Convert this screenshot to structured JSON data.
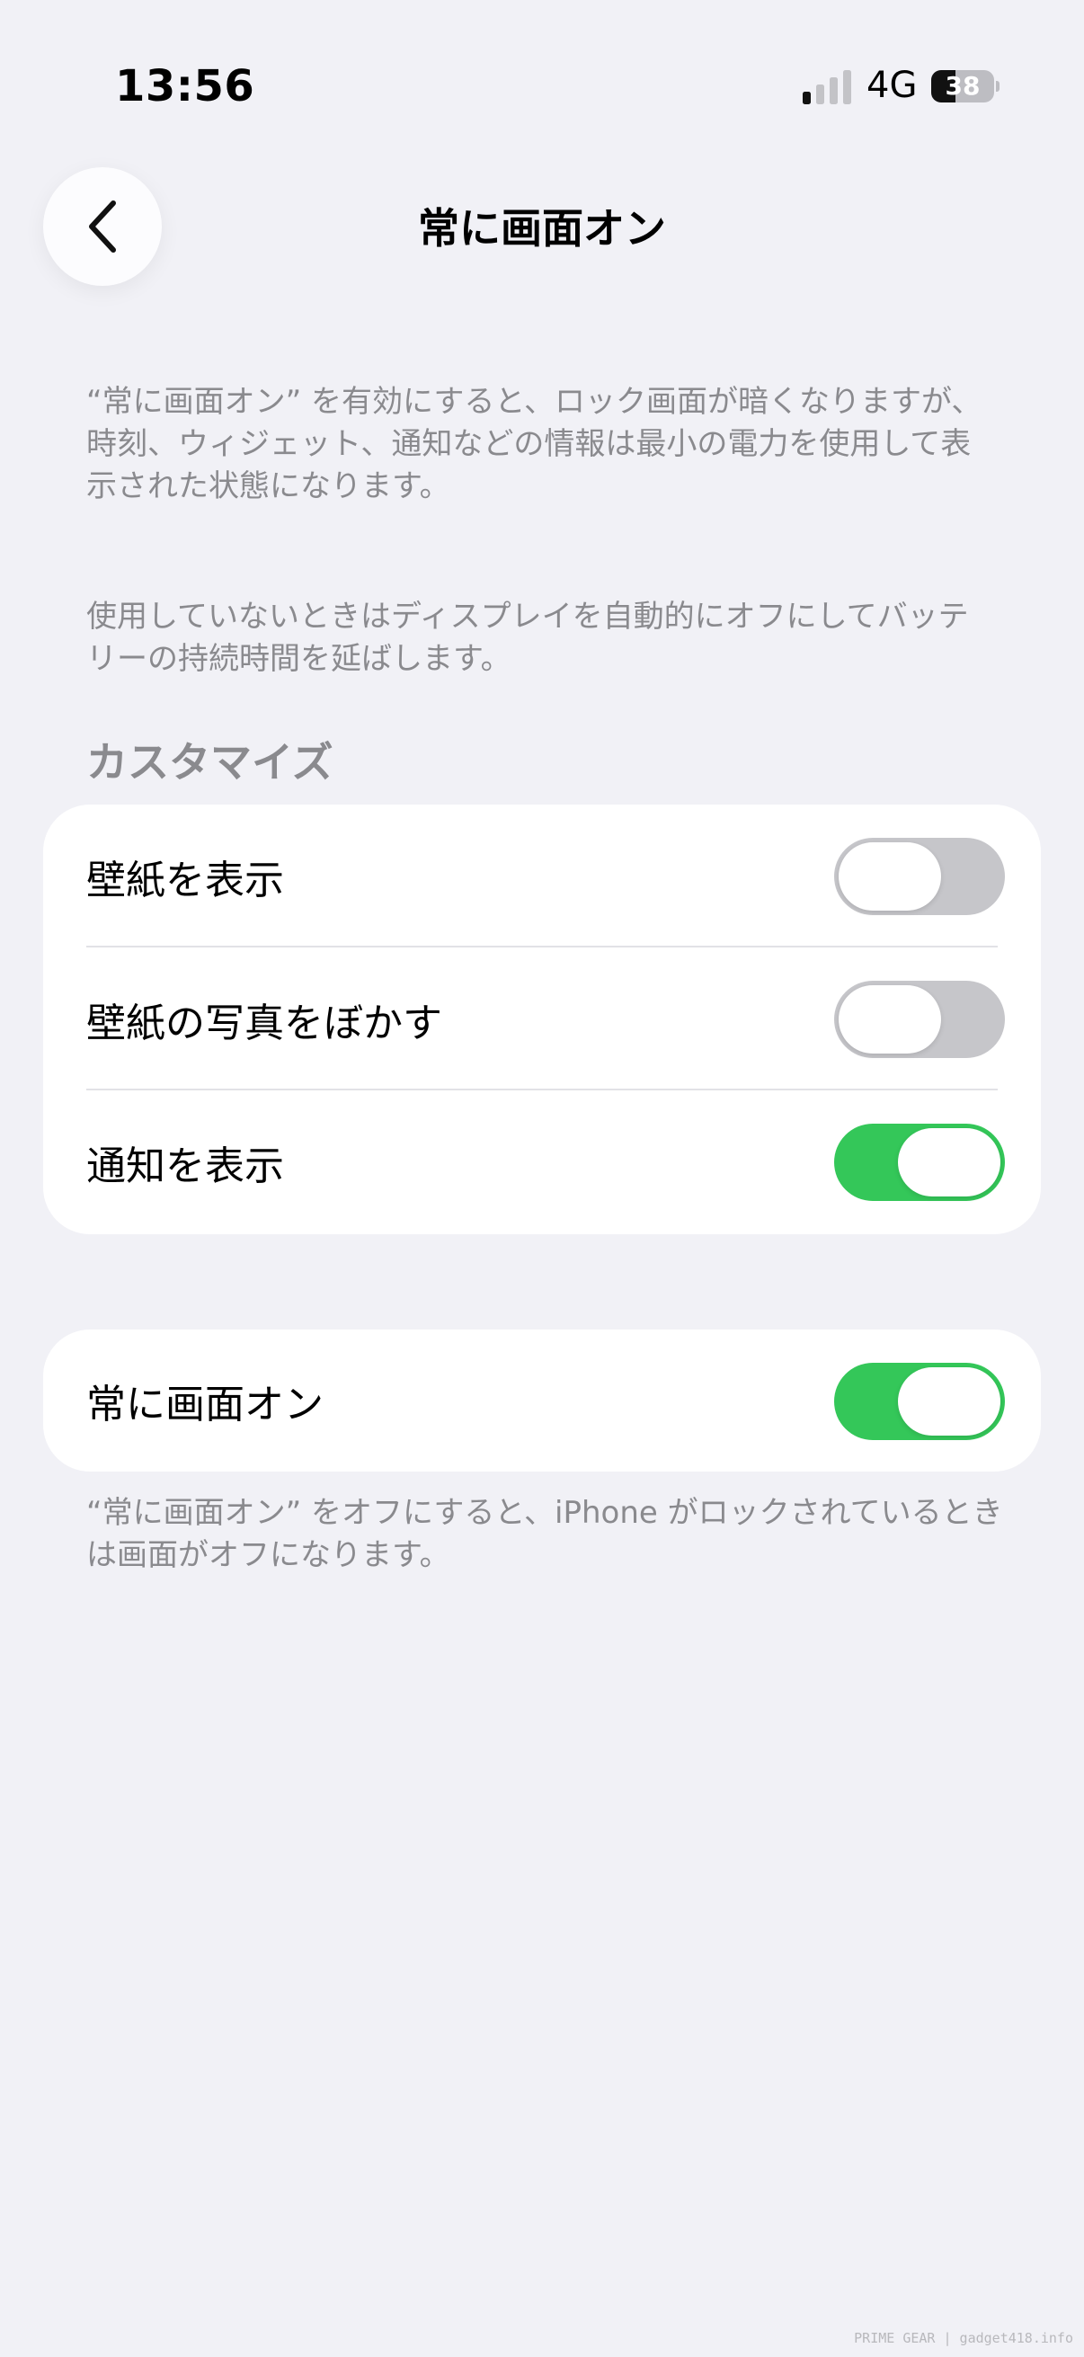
{
  "status_bar": {
    "time": "13:56",
    "network": "4G",
    "battery_percent": "38",
    "battery_level": 0.38,
    "signal_icon": "cellular-signal-icon"
  },
  "nav": {
    "back_icon": "chevron-left-icon",
    "title": "常に画面オン"
  },
  "descriptions": {
    "first": "“常に画面オン” を有効にすると、ロック画面が暗くなりますが、時刻、ウィジェット、通知などの情報は最小の電力を使用して表示された状態になります。",
    "second": "使用していないときはディスプレイを自動的にオフにしてバッテリーの持続時間を延ばします。"
  },
  "customize": {
    "header": "カスタマイズ",
    "rows": [
      {
        "label": "壁紙を表示",
        "on": false
      },
      {
        "label": "壁紙の写真をぼかす",
        "on": false
      },
      {
        "label": "通知を表示",
        "on": true
      }
    ]
  },
  "always_on": {
    "label": "常に画面オン",
    "on": true,
    "footer": "“常に画面オン” をオフにすると、iPhone がロックされているときは画面がオフになります。"
  },
  "colors": {
    "background": "#f1f1f6",
    "toggle_on": "#34c759",
    "toggle_off": "#c6c6ca",
    "secondary_text": "#8a8a8e"
  },
  "watermark": "PRIME GEAR | gadget418.info"
}
